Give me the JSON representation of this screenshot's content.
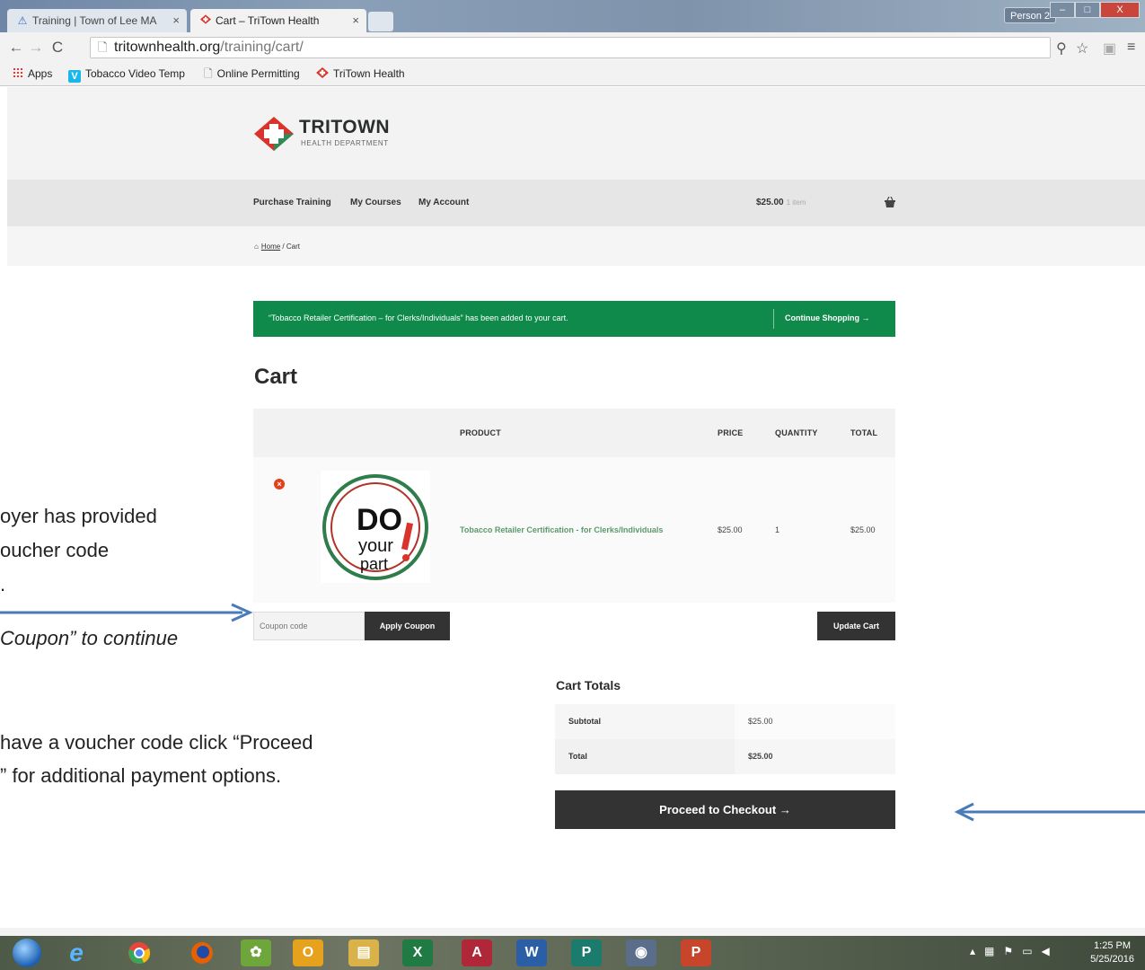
{
  "browser": {
    "tabs": [
      {
        "label": "Training | Town of Lee MA"
      },
      {
        "label": "Cart – TriTown Health"
      }
    ],
    "profile": "Person 2",
    "url_host": "tritownhealth.org",
    "url_path": "/training/cart/",
    "bookmarks": [
      {
        "label": "Apps"
      },
      {
        "label": "Tobacco Video Temp"
      },
      {
        "label": "Online Permitting"
      },
      {
        "label": "TriTown Health"
      }
    ]
  },
  "site": {
    "logo_title": "TRITOWN",
    "logo_subtitle": "HEALTH DEPARTMENT",
    "nav": [
      "Purchase Training",
      "My Courses",
      "My Account"
    ],
    "cart_amount": "$25.00",
    "cart_items": "1 item",
    "breadcrumb": {
      "home": "Home",
      "sep": " / ",
      "current": "Cart"
    }
  },
  "notice": {
    "message": "“Tobacco Retailer Certification – for Clerks/Individuals” has been added to your cart.",
    "continue": "Continue Shopping"
  },
  "cart": {
    "title": "Cart",
    "columns": {
      "product": "PRODUCT",
      "price": "PRICE",
      "quantity": "QUANTITY",
      "total": "TOTAL"
    },
    "items": [
      {
        "product": "Tobacco Retailer Certification - for Clerks/Individuals",
        "price": "$25.00",
        "quantity": "1",
        "total": "$25.00"
      }
    ],
    "coupon_placeholder": "Coupon code",
    "apply_coupon": "Apply Coupon",
    "update_cart": "Update Cart"
  },
  "totals": {
    "title": "Cart Totals",
    "subtotal_label": "Subtotal",
    "subtotal_value": "$25.00",
    "total_label": "Total",
    "total_value": "$25.00",
    "checkout": "Proceed to Checkout"
  },
  "annotations": {
    "line1": "oyer has provided",
    "line2": "oucher code",
    "line3": ".",
    "line4": "Coupon” to continue",
    "line5": "have a voucher code click “Proceed",
    "line6": "” for additional payment options."
  },
  "taskbar": {
    "time": "1:25 PM",
    "date": "5/25/2016"
  },
  "colors": {
    "notice_green": "#0f8a4a",
    "button_dark": "#333333",
    "product_link_green": "#5a9a6a",
    "remove_red": "#e2401c",
    "annotation_arrow": "#4a7ab8"
  }
}
